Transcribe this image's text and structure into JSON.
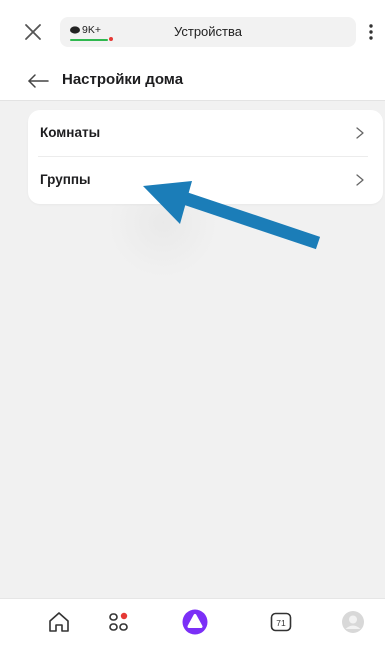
{
  "topbar": {
    "badge_text": "9K+",
    "title": "Устройства",
    "colors": {
      "badge_underline": "#2fb84f",
      "badge_dot": "#e53935"
    }
  },
  "header": {
    "title": "Настройки дома"
  },
  "menu": {
    "items": [
      {
        "label": "Комнаты"
      },
      {
        "label": "Группы"
      }
    ]
  },
  "bottom_nav": {
    "items": [
      {
        "icon": "home-icon"
      },
      {
        "icon": "services-icon"
      },
      {
        "icon": "alice-icon",
        "color": "#7b2ff7"
      },
      {
        "icon": "calendar-icon",
        "count": "71"
      },
      {
        "icon": "profile-icon"
      }
    ]
  },
  "annotation": {
    "arrow_color": "#1b7db8",
    "arrow_icon": "pointer-arrow-icon"
  }
}
